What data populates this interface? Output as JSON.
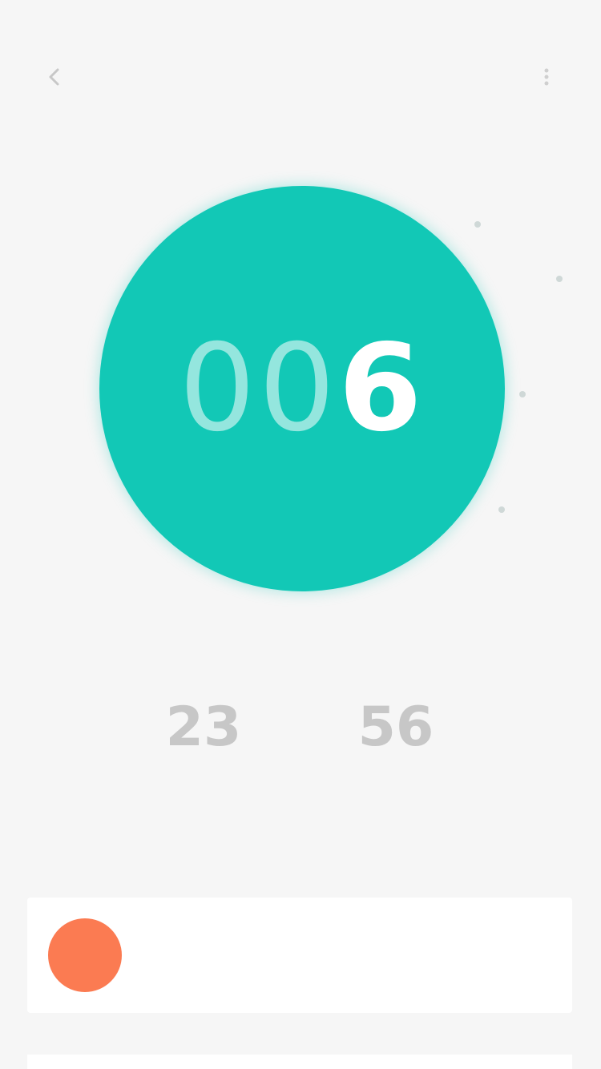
{
  "header": {
    "title": "",
    "subtitle": "",
    "back_icon": "chevron-left-icon",
    "more_icon": "more-icon"
  },
  "counter": {
    "label_top": "",
    "value_faint": "00",
    "value_strong": "6",
    "label_bottom": "",
    "color": "#12c8b6"
  },
  "stats": [
    {
      "value": "23",
      "label": ""
    },
    {
      "value": "56",
      "label": ""
    }
  ],
  "card": {
    "avatar_text": "",
    "name": "",
    "avatar_color": "#fb7b52"
  }
}
